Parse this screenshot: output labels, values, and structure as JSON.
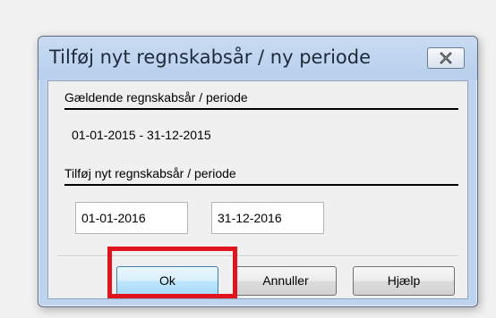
{
  "dialog": {
    "title": "Tilføj nyt regnskabsår / ny periode",
    "current_section_label": "Gældende regnskabsår / periode",
    "current_period": "01-01-2015 - 31-12-2015",
    "new_section_label": "Tilføj nyt regnskabsår / periode",
    "start_date_value": "01-01-2016",
    "end_date_value": "31-12-2016",
    "buttons": {
      "ok": "Ok",
      "cancel": "Annuller",
      "help": "Hjælp"
    }
  },
  "annotation": {
    "highlight_color": "#e0141e",
    "highlighted_control": "ok-button"
  },
  "icons": {
    "close": "close-icon"
  }
}
